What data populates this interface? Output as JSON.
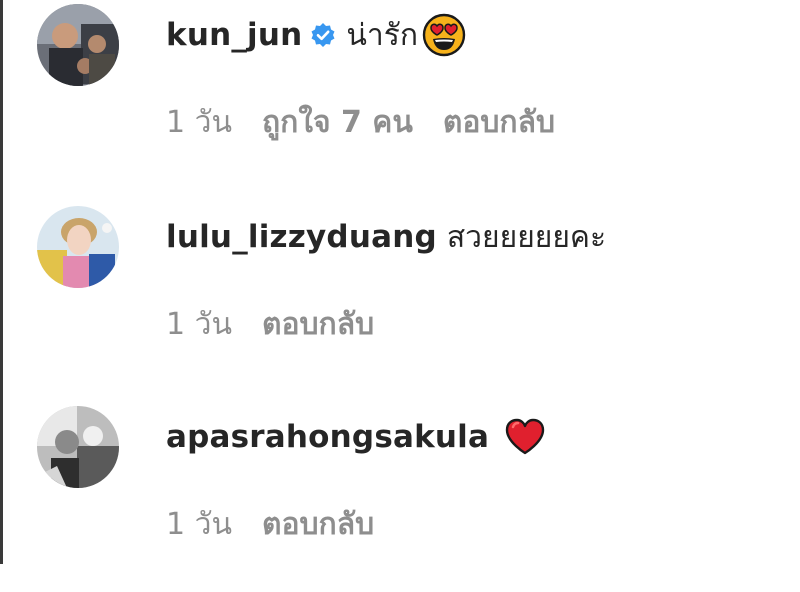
{
  "comments": [
    {
      "username": "kun_jun",
      "verified": true,
      "text": "น่ารัก",
      "emoji": "smiling-face-with-heart-eyes",
      "time": "1 วัน",
      "likes": "ถูกใจ 7 คน",
      "reply": "ตอบกลับ"
    },
    {
      "username": "lulu_lizzyduang",
      "verified": false,
      "text": "สวยยยยยคะ",
      "time": "1 วัน",
      "reply": "ตอบกลับ"
    },
    {
      "username": "apasrahongsakula",
      "verified": false,
      "text": "",
      "emoji": "red-heart",
      "time": "1 วัน",
      "reply": "ตอบกลับ"
    }
  ],
  "colors": {
    "text": "#262626",
    "secondary": "#8e8e8e",
    "verified": "#3897f0",
    "heart": "#e0202e",
    "emoji_face": "#f7b21b"
  }
}
